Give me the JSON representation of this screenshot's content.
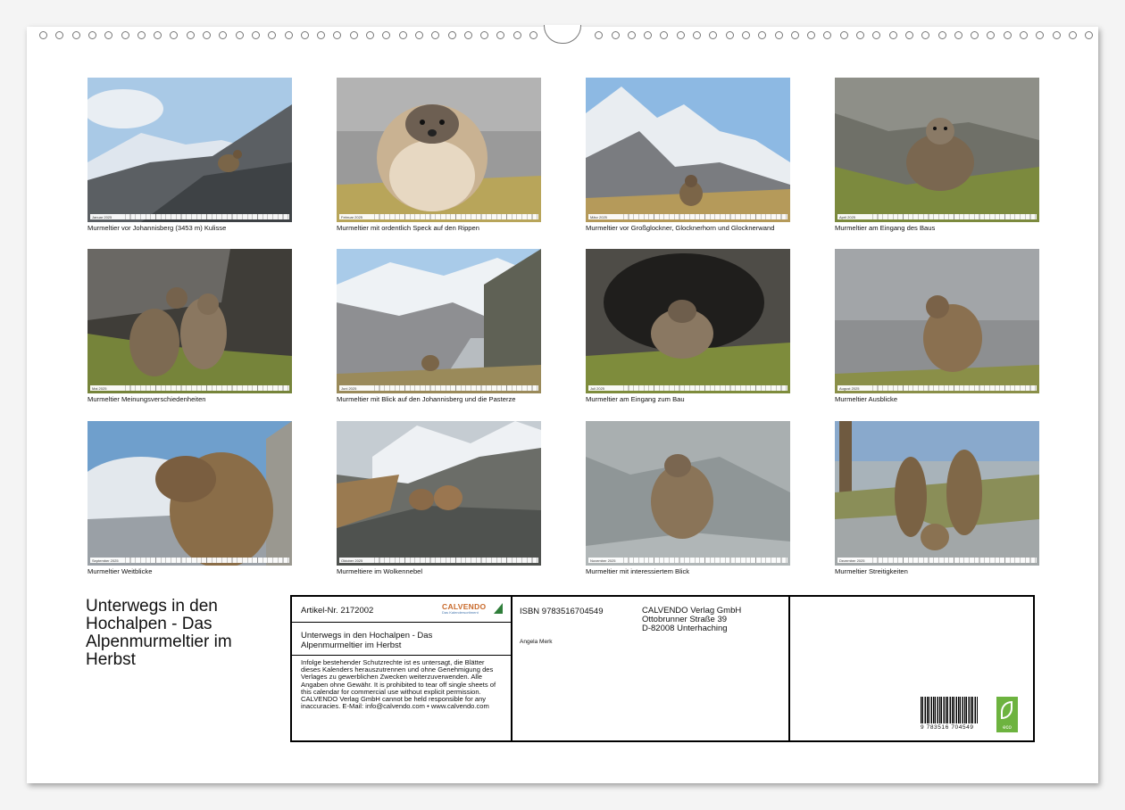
{
  "months": [
    {
      "strip_label": "Januar 2025",
      "caption": "Murmeltier vor Johannisberg (3453 m) Kulisse"
    },
    {
      "strip_label": "Februar 2025",
      "caption": "Murmeltier mit ordentlich Speck auf den Rippen"
    },
    {
      "strip_label": "März 2025",
      "caption": "Murmeltier vor Großglockner, Glocknerhorn und Glocknerwand"
    },
    {
      "strip_label": "April 2025",
      "caption": "Murmeltier am Eingang des Baus"
    },
    {
      "strip_label": "Mai 2025",
      "caption": "Murmeltier Meinungsverschiedenheiten"
    },
    {
      "strip_label": "Juni 2025",
      "caption": "Murmeltier mit Blick auf den Johannisberg und die Pasterze"
    },
    {
      "strip_label": "Juli 2025",
      "caption": "Murmeltier am Eingang zum Bau"
    },
    {
      "strip_label": "August 2025",
      "caption": "Murmeltier Ausblicke"
    },
    {
      "strip_label": "September 2025",
      "caption": "Murmeltier Weitblicke"
    },
    {
      "strip_label": "Oktober 2025",
      "caption": "Murmeltiere im Wolkennebel"
    },
    {
      "strip_label": "November 2025",
      "caption": "Murmeltier mit interessiertem Blick"
    },
    {
      "strip_label": "Dezember 2025",
      "caption": "Murmeltier Streitigkeiten"
    }
  ],
  "title": {
    "line1": "Unterwegs in den",
    "line2": "Hochalpen - Das",
    "line3": "Alpenmurmeltier im",
    "line4": "Herbst"
  },
  "info": {
    "article": "Artikel-Nr. 2172002",
    "logo_name": "CALVENDO",
    "logo_sub": "Das Kalendersortiment",
    "title_line1": "Unterwegs in den Hochalpen - Das",
    "title_line2": "Alpenmurmeltier im Herbst",
    "legal": "Infolge bestehender Schutzrechte ist es untersagt, die Blätter dieses Kalenders herauszutrennen und ohne Genehmigung des Verlages zu gewerblichen Zwecken weiterzuverwenden. Alle Angaben ohne Gewähr. It is prohibited to tear off single sheets of this calendar for commercial use without explicit permission. CALVENDO Verlag GmbH cannot be held responsible for any inaccuracies. E-Mail: info@calvendo.com • www.calvendo.com",
    "isbn": "ISBN 9783516704549",
    "author": "Angela Merk",
    "publisher_line1": "CALVENDO Verlag GmbH",
    "publisher_line2": "Ottobrunner Straße 39",
    "publisher_line3": "D-82008 Unterhaching",
    "barcode_number": "9 783516 704549",
    "eco_label": "eco"
  },
  "colors": {
    "sky": "#9cc6e8",
    "rock": "#7d7d7d",
    "snow": "#f2f4f6",
    "marmot": "#8a6d4a",
    "grass": "#8f9a4a",
    "eco_green": "#6db33f",
    "calvendo_orange": "#c8692a"
  }
}
